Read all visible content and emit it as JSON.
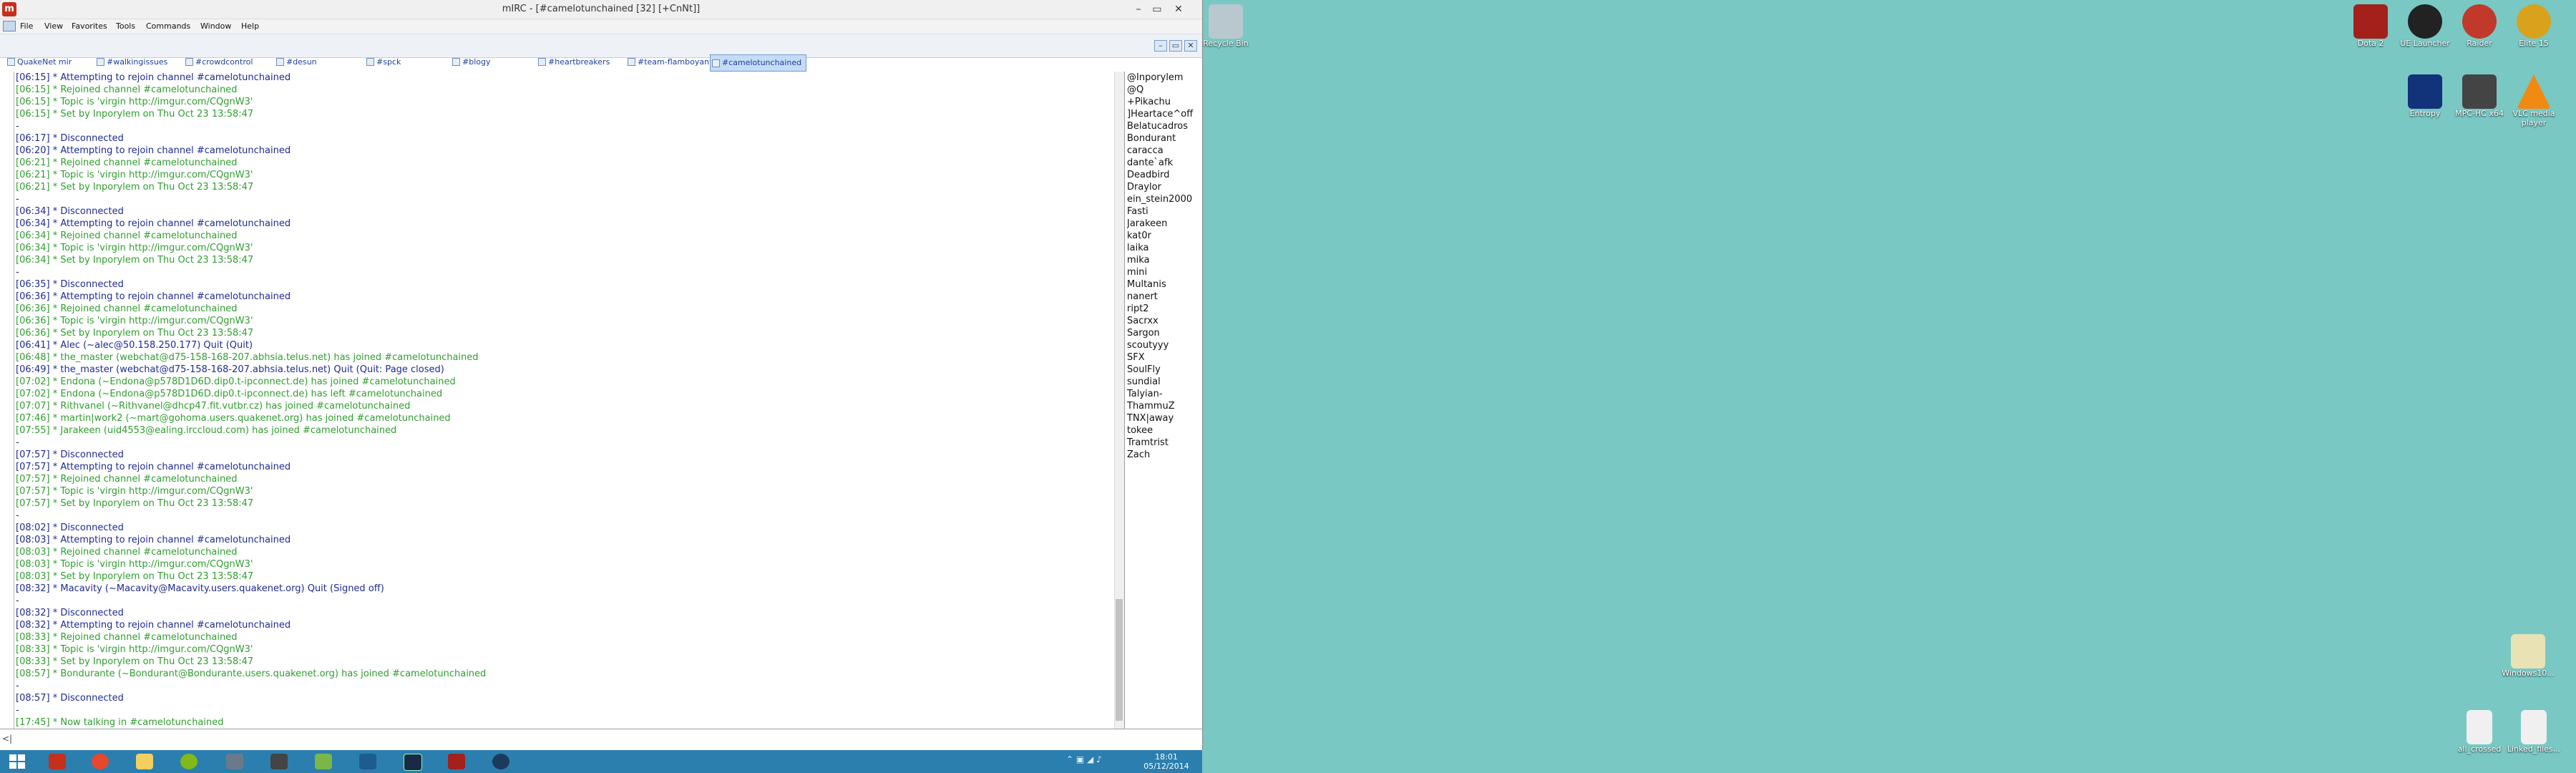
{
  "window": {
    "title": "mIRC - [#camelotunchained [32] [+CnNt]]",
    "app_icon_text": "m",
    "minimize": "–",
    "maximize": "▭",
    "close": "✕"
  },
  "menu": [
    "File",
    "View",
    "Favorites",
    "Tools",
    "Commands",
    "Window",
    "Help"
  ],
  "tabs": [
    {
      "label": "QuakeNet mir"
    },
    {
      "label": "#walkingissues"
    },
    {
      "label": "#crowdcontrol"
    },
    {
      "label": "#desun"
    },
    {
      "label": "#spck"
    },
    {
      "label": "#blogy"
    },
    {
      "label": "#heartbreakers"
    },
    {
      "label": "#team-flamboyant"
    },
    {
      "label": "#camelotunchained"
    }
  ],
  "mdi": [
    "–",
    "▭",
    "✕"
  ],
  "chat_lines": [
    {
      "t": "[06:15] * Attempting to rejoin channel #camelotunchained",
      "c": "blue"
    },
    {
      "t": "[06:15] * Rejoined channel #camelotunchained",
      "c": "green"
    },
    {
      "t": "[06:15] * Topic is 'virgin http://imgur.com/CQgnW3'",
      "c": "green"
    },
    {
      "t": "[06:15] * Set by Inporylem on Thu Oct 23 13:58:47",
      "c": "green"
    },
    {
      "t": "-",
      "c": "blue"
    },
    {
      "t": "[06:17] * Disconnected",
      "c": "blue"
    },
    {
      "t": "[06:20] * Attempting to rejoin channel #camelotunchained",
      "c": "blue"
    },
    {
      "t": "[06:21] * Rejoined channel #camelotunchained",
      "c": "green"
    },
    {
      "t": "[06:21] * Topic is 'virgin http://imgur.com/CQgnW3'",
      "c": "green"
    },
    {
      "t": "[06:21] * Set by Inporylem on Thu Oct 23 13:58:47",
      "c": "green"
    },
    {
      "t": "-",
      "c": "blue"
    },
    {
      "t": "[06:34] * Disconnected",
      "c": "blue"
    },
    {
      "t": "[06:34] * Attempting to rejoin channel #camelotunchained",
      "c": "blue"
    },
    {
      "t": "[06:34] * Rejoined channel #camelotunchained",
      "c": "green"
    },
    {
      "t": "[06:34] * Topic is 'virgin http://imgur.com/CQgnW3'",
      "c": "green"
    },
    {
      "t": "[06:34] * Set by Inporylem on Thu Oct 23 13:58:47",
      "c": "green"
    },
    {
      "t": "-",
      "c": "blue"
    },
    {
      "t": "[06:35] * Disconnected",
      "c": "blue"
    },
    {
      "t": "[06:36] * Attempting to rejoin channel #camelotunchained",
      "c": "blue"
    },
    {
      "t": "[06:36] * Rejoined channel #camelotunchained",
      "c": "green"
    },
    {
      "t": "[06:36] * Topic is 'virgin http://imgur.com/CQgnW3'",
      "c": "green"
    },
    {
      "t": "[06:36] * Set by Inporylem on Thu Oct 23 13:58:47",
      "c": "green"
    },
    {
      "t": "[06:41] * Alec (~alec@50.158.250.177) Quit (Quit)",
      "c": "blue"
    },
    {
      "t": "[06:48] * the_master (webchat@d75-158-168-207.abhsia.telus.net) has joined #camelotunchained",
      "c": "green"
    },
    {
      "t": "[06:49] * the_master (webchat@d75-158-168-207.abhsia.telus.net) Quit (Quit: Page closed)",
      "c": "blue"
    },
    {
      "t": "[07:02] * Endona (~Endona@p578D1D6D.dip0.t-ipconnect.de) has joined #camelotunchained",
      "c": "green"
    },
    {
      "t": "[07:02] * Endona (~Endona@p578D1D6D.dip0.t-ipconnect.de) has left #camelotunchained",
      "c": "green"
    },
    {
      "t": "[07:07] * Rithvanel (~Rithvanel@dhcp47.fit.vutbr.cz) has joined #camelotunchained",
      "c": "green"
    },
    {
      "t": "[07:46] * martin|work2 (~mart@gohoma.users.quakenet.org) has joined #camelotunchained",
      "c": "green"
    },
    {
      "t": "[07:55] * Jarakeen (uid4553@ealing.irccloud.com) has joined #camelotunchained",
      "c": "green"
    },
    {
      "t": "-",
      "c": "blue"
    },
    {
      "t": "[07:57] * Disconnected",
      "c": "blue"
    },
    {
      "t": "[07:57] * Attempting to rejoin channel #camelotunchained",
      "c": "blue"
    },
    {
      "t": "[07:57] * Rejoined channel #camelotunchained",
      "c": "green"
    },
    {
      "t": "[07:57] * Topic is 'virgin http://imgur.com/CQgnW3'",
      "c": "green"
    },
    {
      "t": "[07:57] * Set by Inporylem on Thu Oct 23 13:58:47",
      "c": "green"
    },
    {
      "t": "-",
      "c": "blue"
    },
    {
      "t": "[08:02] * Disconnected",
      "c": "blue"
    },
    {
      "t": "[08:03] * Attempting to rejoin channel #camelotunchained",
      "c": "blue"
    },
    {
      "t": "[08:03] * Rejoined channel #camelotunchained",
      "c": "green"
    },
    {
      "t": "[08:03] * Topic is 'virgin http://imgur.com/CQgnW3'",
      "c": "green"
    },
    {
      "t": "[08:03] * Set by Inporylem on Thu Oct 23 13:58:47",
      "c": "green"
    },
    {
      "t": "[08:32] * Macavity (~Macavity@Macavity.users.quakenet.org) Quit (Signed off)",
      "c": "blue"
    },
    {
      "t": "-",
      "c": "blue"
    },
    {
      "t": "[08:32] * Disconnected",
      "c": "blue"
    },
    {
      "t": "[08:32] * Attempting to rejoin channel #camelotunchained",
      "c": "blue"
    },
    {
      "t": "[08:33] * Rejoined channel #camelotunchained",
      "c": "green"
    },
    {
      "t": "[08:33] * Topic is 'virgin http://imgur.com/CQgnW3'",
      "c": "green"
    },
    {
      "t": "[08:33] * Set by Inporylem on Thu Oct 23 13:58:47",
      "c": "green"
    },
    {
      "t": "[08:57] * Bondurante (~Bondurant@Bondurante.users.quakenet.org) has joined #camelotunchained",
      "c": "green"
    },
    {
      "t": "-",
      "c": "blue"
    },
    {
      "t": "[08:57] * Disconnected",
      "c": "blue"
    },
    {
      "t": "-",
      "c": "blue"
    },
    {
      "t": "[17:45] * Now talking in #camelotunchained",
      "c": "green"
    }
  ],
  "nicks": [
    "@Inporylem",
    "@Q",
    "+Pikachu",
    "]Heartace^off",
    "Belatucadros",
    "Bondurant",
    "caracca",
    "dante`afk",
    "Deadbird",
    "Draylor",
    "ein_stein2000",
    "Fasti",
    "Jarakeen",
    "kat0r",
    "laika",
    "mika",
    "mini",
    "Multanis",
    "nanert",
    "ript2",
    "Sacrxx",
    "Sargon",
    "scoutyyy",
    "SFX",
    "SoulFly",
    "sundial",
    "Talyian-",
    "ThammuZ",
    "TNX|away",
    "tokee",
    "Tramtrist",
    "Zach"
  ],
  "input": {
    "prefix": "<|",
    "value": ""
  },
  "taskbar": {
    "clock_time": "18:01",
    "clock_date": "05/12/2014",
    "tray": "⌃ ▣ ◢ ♪"
  },
  "desktop_icons": [
    {
      "label": "Recycle Bin",
      "color": "#b9c7cf"
    },
    {
      "label": "Dota 2",
      "color": "#a3201b"
    },
    {
      "label": "UE Launcher",
      "color": "#222"
    },
    {
      "label": "Raider",
      "color": "#c0392b"
    },
    {
      "label": "Elite 15",
      "color": "#d8a21c"
    },
    {
      "label": "Entropy",
      "color": "#12327a"
    },
    {
      "label": "MPC-HC x64",
      "color": "#444"
    },
    {
      "label": "VLC media player",
      "color": "#f08a12"
    },
    {
      "label": "Windows10...",
      "color": "#e9e2b4"
    },
    {
      "label": "all_crossed",
      "color": "#f0f0f0"
    },
    {
      "label": "Linked_files...",
      "color": "#f0f0f0"
    }
  ]
}
